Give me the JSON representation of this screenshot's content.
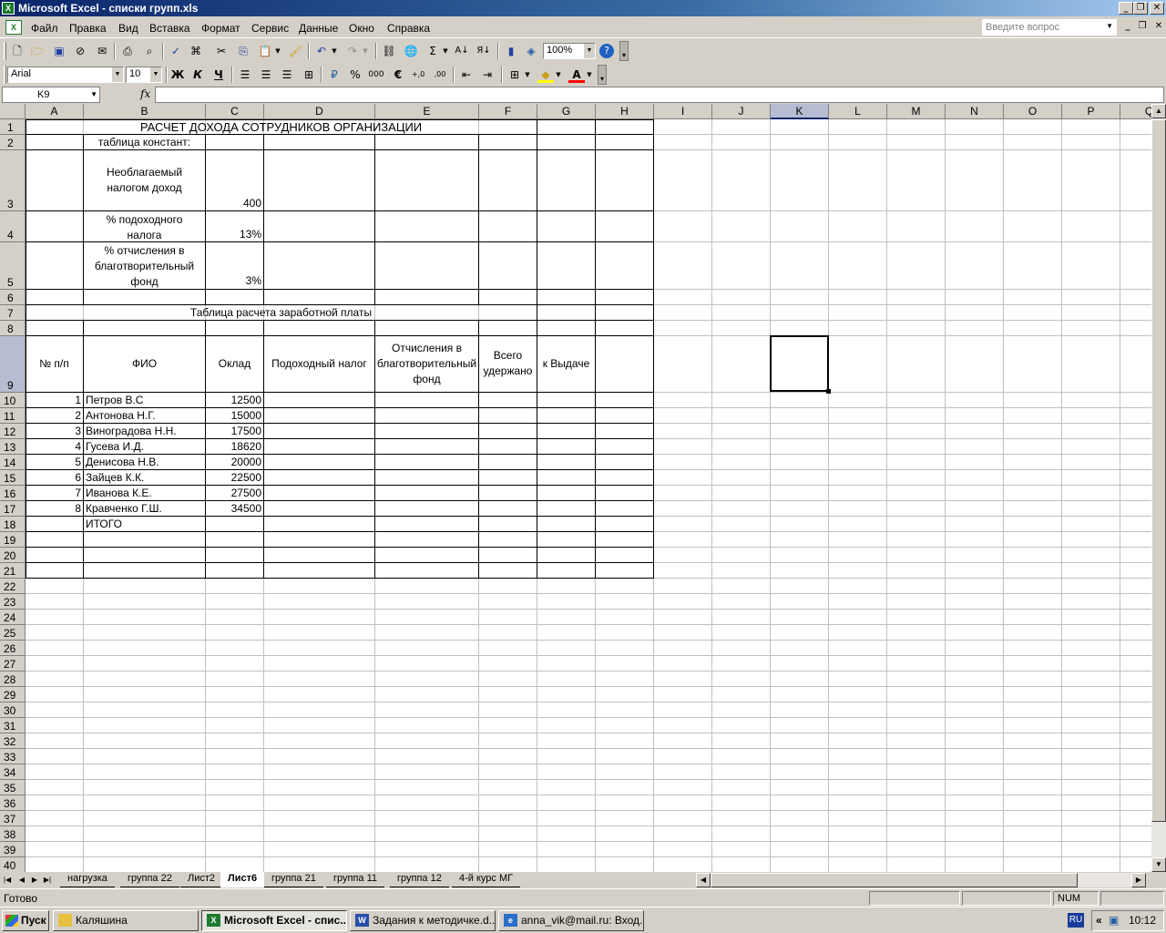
{
  "window": {
    "title": "Microsoft Excel - списки групп.xls",
    "app_icon": "X"
  },
  "menu": {
    "items": [
      "Файл",
      "Правка",
      "Вид",
      "Вставка",
      "Формат",
      "Сервис",
      "Данные",
      "Окно",
      "Справка"
    ],
    "help_placeholder": "Введите вопрос"
  },
  "toolbar": {
    "zoom": "100%",
    "font": "Arial",
    "size": "10",
    "bold": "Ж",
    "italic": "К",
    "underline": "Ч"
  },
  "formula_bar": {
    "name_box": "K9",
    "fx": "fx",
    "content": ""
  },
  "columns": [
    "A",
    "B",
    "C",
    "D",
    "E",
    "F",
    "G",
    "H",
    "I",
    "J",
    "K",
    "L",
    "M",
    "N",
    "O",
    "P",
    "Q"
  ],
  "rows": [
    "1",
    "2",
    "3",
    "4",
    "5",
    "6",
    "7",
    "8",
    "9",
    "10",
    "11",
    "12",
    "13",
    "14",
    "15",
    "16",
    "17",
    "18",
    "19",
    "20",
    "21",
    "22",
    "23",
    "24",
    "25",
    "26",
    "27",
    "28",
    "29",
    "30",
    "31",
    "32",
    "33",
    "34",
    "35",
    "36",
    "37",
    "38",
    "39",
    "40"
  ],
  "selected": {
    "column": "K",
    "row": "9"
  },
  "sheet": {
    "title": "РАСЧЕТ ДОХОДА СОТРУДНИКОВ ОРГАНИЗАЦИИ",
    "constants_header": "таблица констант:",
    "constants": [
      {
        "label": "Необлагаемый налогом доход",
        "value": "400"
      },
      {
        "label": "% подоходного налога",
        "value": "13%"
      },
      {
        "label": "% отчисления в благотворительный фонд",
        "value": "3%"
      }
    ],
    "table_title": "Таблица расчета заработной платы",
    "headers": [
      "№ п/п",
      "ФИО",
      "Оклад",
      "Подоходный налог",
      "Отчисления в благотворительный фонд",
      "Всего удержано",
      "к Выдаче"
    ],
    "employees": [
      {
        "n": "1",
        "name": "Петров В.С",
        "salary": "12500"
      },
      {
        "n": "2",
        "name": "Антонова Н.Г.",
        "salary": "15000"
      },
      {
        "n": "3",
        "name": "Виноградова Н.Н.",
        "salary": "17500"
      },
      {
        "n": "4",
        "name": "Гусева И.Д.",
        "salary": "18620"
      },
      {
        "n": "5",
        "name": "Денисова Н.В.",
        "salary": "20000"
      },
      {
        "n": "6",
        "name": "Зайцев К.К.",
        "salary": "22500"
      },
      {
        "n": "7",
        "name": "Иванова К.Е.",
        "salary": "27500"
      },
      {
        "n": "8",
        "name": "Кравченко Г.Ш.",
        "salary": "34500"
      }
    ],
    "total_label": "ИТОГО"
  },
  "sheet_tabs": [
    "нагрузка",
    "группа 22",
    "Лист2",
    "Лист6",
    "группа 21",
    "группа 11",
    "группа 12",
    "4-й курс МГ"
  ],
  "active_tab": "Лист6",
  "status": {
    "text": "Готово",
    "num": "NUM"
  },
  "taskbar": {
    "start": "Пуск",
    "tasks": [
      "Каляшина",
      "Microsoft Excel - спис...",
      "Задания к методичке.d...",
      "anna_vik@mail.ru: Вход..."
    ],
    "lang": "RU",
    "clock": "10:12"
  }
}
